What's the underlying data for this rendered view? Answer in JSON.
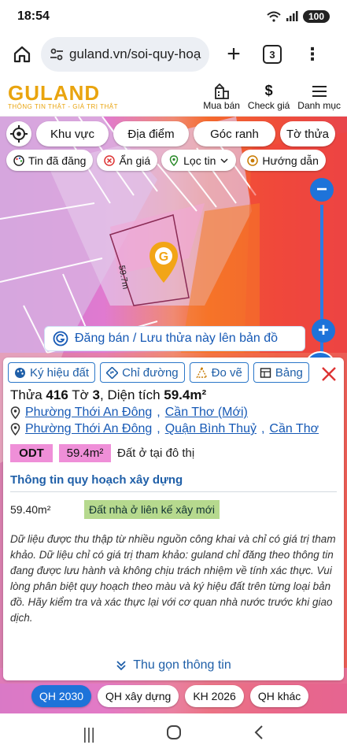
{
  "status": {
    "time": "18:54",
    "battery": "100"
  },
  "browser": {
    "url": "guland.vn/soi-quy-hoạch",
    "tab_count": "3"
  },
  "app": {
    "logo": "GULAND",
    "tagline": "THÔNG TIN THẬT - GIÁ TRỊ THẬT",
    "nav": [
      {
        "label": "Mua bán"
      },
      {
        "label": "Check giá"
      },
      {
        "label": "Danh mục"
      }
    ]
  },
  "map": {
    "filters_row1": [
      "Khu vực",
      "Địa điểm",
      "Góc ranh",
      "Tờ thửa"
    ],
    "filters_row2": [
      "Tin đã đăng",
      "Ẩn giá",
      "Lọc tin",
      "Hướng dẫn"
    ],
    "plot_dimension": "59.7m",
    "zoom_level": "100",
    "post_button": "Đăng bán / Lưu thửa này lên bản đồ",
    "colors": {
      "odt": "#ef8fd8",
      "accent": "#1e73d9"
    }
  },
  "panel": {
    "tabs": [
      "Ký hiệu đất",
      "Chỉ đường",
      "Đo vẽ",
      "Bảng"
    ],
    "title": {
      "thua_label": "Thửa",
      "thua": "416",
      "to_label": "Tờ",
      "to": "3",
      "area_label": "Diện tích",
      "area": "59.4m²"
    },
    "address_new": [
      "Phường Thới An Đông",
      "Cần Thơ (Mới)"
    ],
    "address_old": [
      "Phường Thới An Đông",
      "Quận Bình Thuỷ",
      "Cần Thơ"
    ],
    "land_code": "ODT",
    "land_area": "59.4m²",
    "land_desc": "Đất ở tại đô thị",
    "section_title": "Thông tin quy hoạch xây dựng",
    "plan_area": "59.40m²",
    "plan_tag": "Đất nhà ở liên kế xây mới",
    "disclaimer": "Dữ liệu được thu thập từ nhiều nguồn công khai và chỉ có giá trị tham khảo. Dữ liệu chỉ có giá trị tham khảo: guland chỉ đăng theo thông tin đang được lưu hành và không chịu trách nhiệm về tính xác thực. Vui lòng phân biệt quy hoạch theo màu và ký hiệu đất trên từng loại bản đồ. Hãy kiểm tra và xác thực lại với cơ quan nhà nước trước khi giao dịch.",
    "collapse": "Thu gọn thông tin"
  },
  "bottom_chips": [
    "QH 2030",
    "QH xây dựng",
    "KH 2026",
    "QH khác"
  ]
}
